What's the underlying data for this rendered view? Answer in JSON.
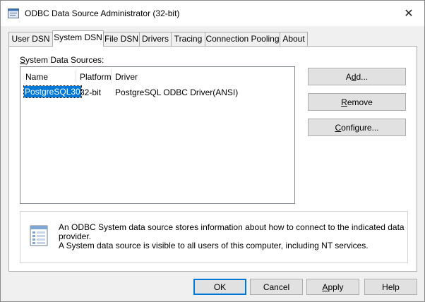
{
  "window": {
    "title": "ODBC Data Source Administrator (32-bit)",
    "close_glyph": "✕"
  },
  "tabs": [
    {
      "label": "User DSN"
    },
    {
      "label": "System DSN",
      "active": true
    },
    {
      "label": "File DSN"
    },
    {
      "label": "Drivers"
    },
    {
      "label": "Tracing"
    },
    {
      "label": "Connection Pooling"
    },
    {
      "label": "About"
    }
  ],
  "system_dsn": {
    "list_label_prefix": "S",
    "list_label_rest": "ystem Data Sources:",
    "columns": [
      "Name",
      "Platform",
      "Driver"
    ],
    "rows": [
      {
        "name": "PostgreSQL30",
        "platform": "32-bit",
        "driver": "PostgreSQL ODBC Driver(ANSI)"
      }
    ],
    "buttons": {
      "add_pre": "A",
      "add_u": "d",
      "add_post": "d...",
      "remove_u": "R",
      "remove_post": "emove",
      "configure_u": "C",
      "configure_post": "onfigure..."
    },
    "info_line1": "An ODBC System data source stores information about how to connect to the indicated data provider.",
    "info_line2": "A System data source is visible to all users of this computer, including NT services."
  },
  "footer": {
    "ok": "OK",
    "cancel": "Cancel",
    "apply_u": "A",
    "apply_post": "pply",
    "help": "Help"
  },
  "colors": {
    "selection": "#0078d7",
    "button_face": "#e1e1e1",
    "dialog_bg": "#f0f0f0"
  }
}
